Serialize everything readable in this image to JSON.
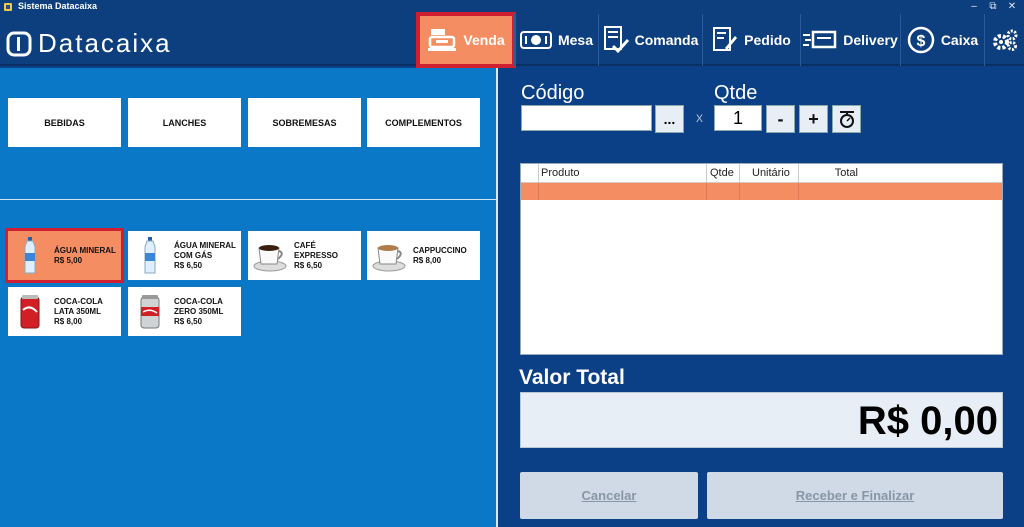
{
  "window": {
    "title": "Sistema Datacaixa",
    "controls": [
      "–",
      "⧉",
      "✕"
    ]
  },
  "brand": {
    "name": "Datacaixa"
  },
  "nav": [
    {
      "label": "Venda",
      "icon": "cash-register-icon",
      "active": true
    },
    {
      "label": "Mesa",
      "icon": "table-icon"
    },
    {
      "label": "Comanda",
      "icon": "checklist-icon"
    },
    {
      "label": "Pedido",
      "icon": "order-pencil-icon"
    },
    {
      "label": "Delivery",
      "icon": "delivery-truck-icon"
    },
    {
      "label": "Caixa",
      "icon": "dollar-circle-icon"
    },
    {
      "label": "",
      "icon": "gears-icon"
    }
  ],
  "categories": [
    "BEBIDAS",
    "LANCHES",
    "SOBREMESAS",
    "COMPLEMENTOS"
  ],
  "products": [
    {
      "name": "ÁGUA MINERAL",
      "price": "R$ 5,00",
      "icon": "water-bottle-icon",
      "selected": true
    },
    {
      "name": "ÁGUA MINERAL COM GÁS",
      "price": "R$ 6,50",
      "icon": "water-bottle-icon"
    },
    {
      "name": "CAFÉ EXPRESSO",
      "price": "R$ 6,50",
      "icon": "coffee-cup-icon"
    },
    {
      "name": "CAPPUCCINO",
      "price": "R$ 8,00",
      "icon": "coffee-cup-icon"
    },
    {
      "name": "COCA-COLA LATA 350ML",
      "price": "R$ 8,00",
      "icon": "soda-can-red-icon"
    },
    {
      "name": "COCA-COLA ZERO 350ML",
      "price": "R$ 6,50",
      "icon": "soda-can-silver-icon"
    }
  ],
  "order": {
    "codigo_label": "Código",
    "codigo_value": "",
    "lookup_label": "...",
    "times_sign": "x",
    "qtde_label": "Qtde",
    "qtde_value": "1",
    "minus_label": "-",
    "plus_label": "+",
    "scale_icon": "scale-icon",
    "columns": [
      "Produto",
      "Qtde",
      "Unitário",
      "Total"
    ],
    "valor_total_label": "Valor Total",
    "valor_total": "R$ 0,00",
    "cancel_label": "Cancelar",
    "finish_label": "Receber e Finalizar"
  },
  "colors": {
    "header_bg": "#0d3e7d",
    "left_bg": "#0a77c7",
    "accent": "#f58d62",
    "highlight": "#cf1f30"
  }
}
